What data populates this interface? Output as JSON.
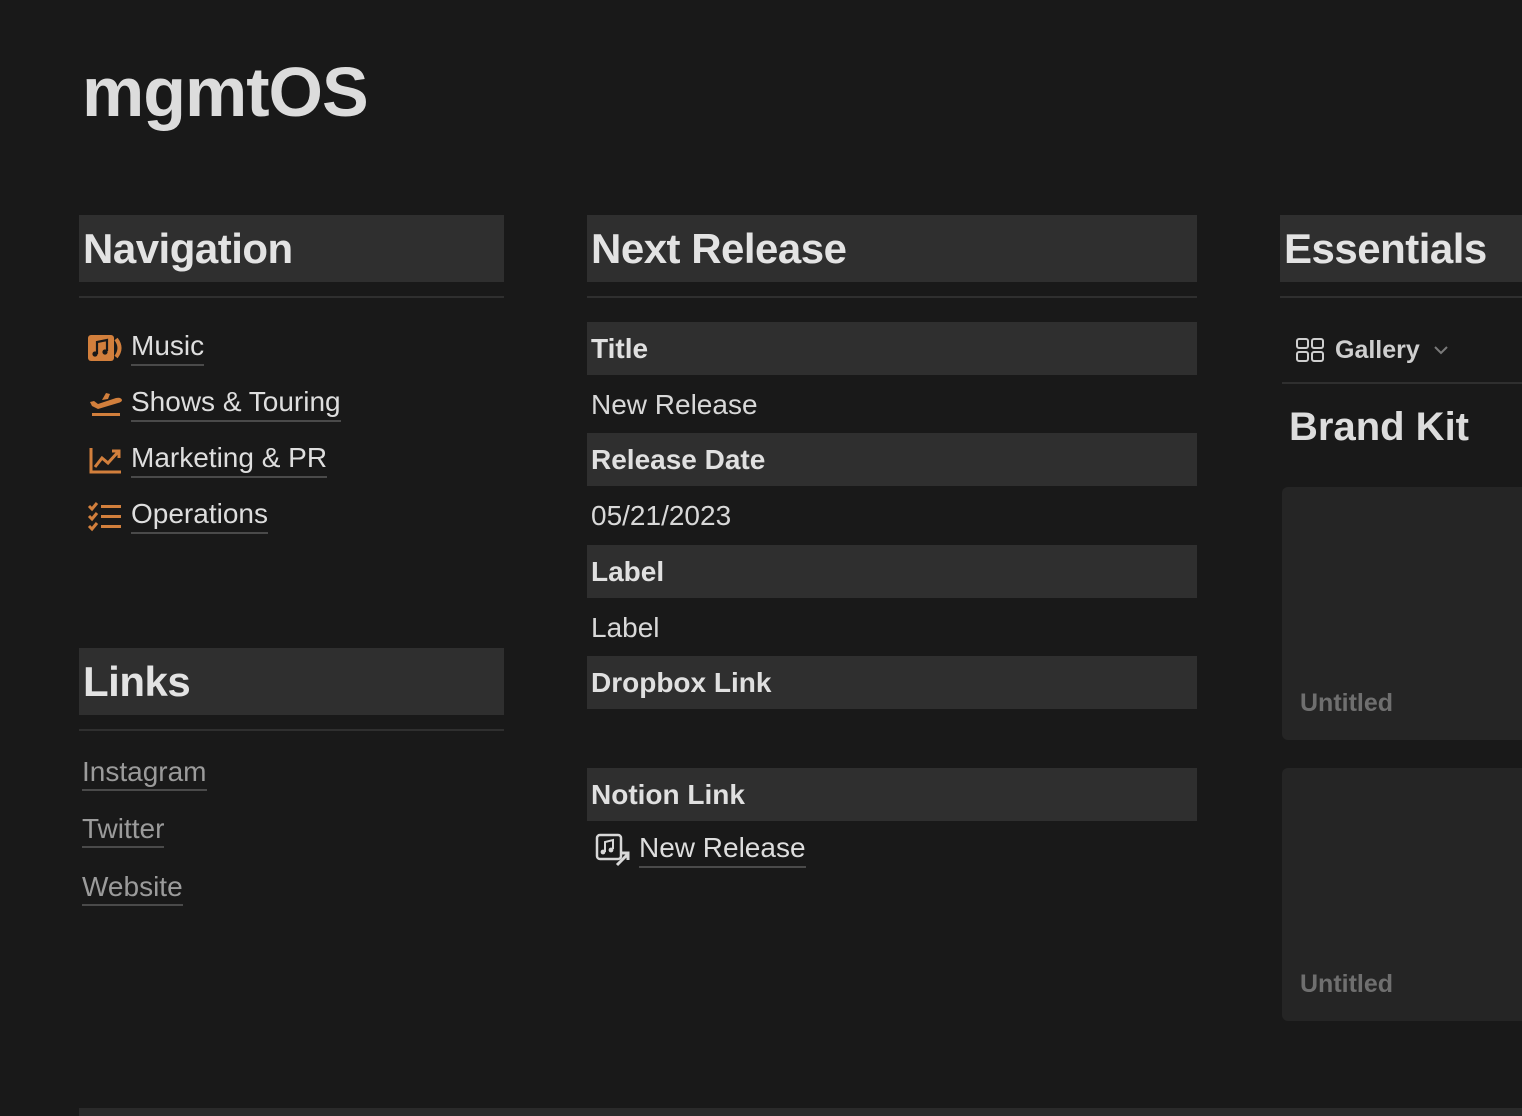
{
  "page": {
    "title": "mgmtOS"
  },
  "navigation": {
    "heading": "Navigation",
    "items": [
      {
        "label": "Music",
        "icon": "music-album-icon"
      },
      {
        "label": "Shows & Touring",
        "icon": "airplane-takeoff-icon"
      },
      {
        "label": "Marketing & PR",
        "icon": "trending-chart-icon"
      },
      {
        "label": "Operations",
        "icon": "checklist-icon"
      }
    ]
  },
  "links": {
    "heading": "Links",
    "items": [
      "Instagram",
      "Twitter",
      "Website"
    ]
  },
  "next_release": {
    "heading": "Next Release",
    "properties": [
      {
        "name": "Title",
        "value": "New Release"
      },
      {
        "name": "Release Date",
        "value": "05/21/2023"
      },
      {
        "name": "Label",
        "value": "Label"
      },
      {
        "name": "Dropbox Link",
        "value": ""
      },
      {
        "name": "Notion Link",
        "value": "New Release"
      }
    ]
  },
  "essentials": {
    "heading": "Essentials",
    "view_label": "Gallery",
    "group_title": "Brand Kit",
    "cards": [
      "Untitled",
      "Untitled"
    ]
  },
  "colors": {
    "accent": "#d27f3c",
    "background": "#191919",
    "header_bg": "#2f2f2f"
  }
}
